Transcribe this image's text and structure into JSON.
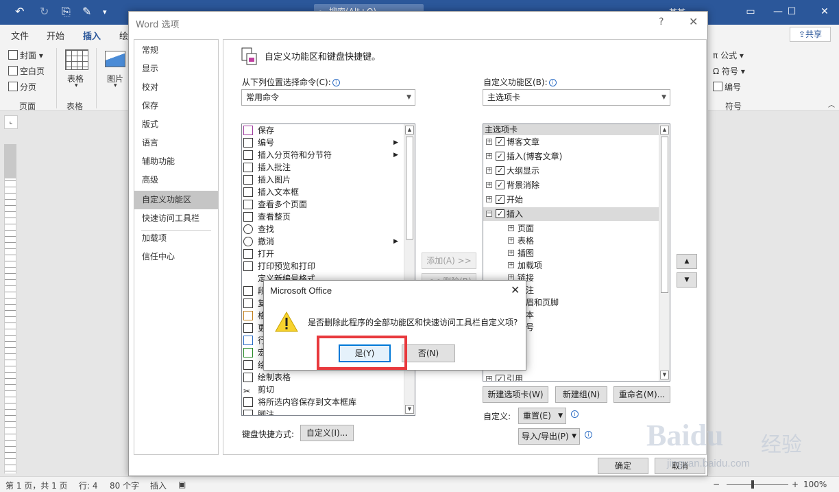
{
  "word": {
    "search_label": "搜索(Alt+Q)",
    "user_name": "某某",
    "ribbon_tabs": [
      "文件",
      "开始",
      "插入",
      "绘"
    ],
    "share_label": "共享",
    "ribbon": {
      "cover": "封面",
      "blank_page": "空白页",
      "page_break": "分页",
      "table": "表格",
      "picture": "图片",
      "group_pages": "页面",
      "group_table": "表格",
      "formula": "公式",
      "symbol": "符号",
      "numbering": "编号",
      "group_symbols": "符号"
    },
    "status": {
      "page": "第 1 页，共 1 页",
      "line": "行: 4",
      "words": "80 个字",
      "mode": "插入",
      "zoom": "100%"
    }
  },
  "options": {
    "title": "Word 选项",
    "help": "?",
    "close": "✕",
    "nav": [
      "常规",
      "显示",
      "校对",
      "保存",
      "版式",
      "语言",
      "辅助功能",
      "高级",
      "自定义功能区",
      "快速访问工具栏",
      "加载项",
      "信任中心"
    ],
    "nav_selected": "自定义功能区",
    "heading": "自定义功能区和键盘快捷键。",
    "choose_from_label": "从下列位置选择命令(C):",
    "choose_from_value": "常用命令",
    "customize_label": "自定义功能区(B):",
    "customize_value": "主选项卡",
    "commands": [
      "保存",
      "编号",
      "插入分页符和分节符",
      "插入批注",
      "插入图片",
      "插入文本框",
      "查看多个页面",
      "查看整页",
      "查找",
      "撤消",
      "打开",
      "打印预览和打印",
      "定义新编号格式...",
      "段",
      "复",
      "格",
      "更",
      "行",
      "宏",
      "绘",
      "绘制表格",
      "剪切",
      "将所选内容保存到文本框库",
      "脚注"
    ],
    "tree_header": "主选项卡",
    "tree_items": [
      "博客文章",
      "插入(博客文章)",
      "大纲显示",
      "背景消除",
      "开始",
      "插入"
    ],
    "tree_children": [
      "页面",
      "表格",
      "插图",
      "加载项",
      "链接",
      "注",
      "眉和页脚",
      "本",
      "号"
    ],
    "tree_last": "引用",
    "add_btn": "添加(A) >>",
    "remove_btn": "<< 删除(R)",
    "new_tab_btn": "新建选项卡(W)",
    "new_group_btn": "新建组(N)",
    "rename_btn": "重命名(M)...",
    "customizations_label": "自定义:",
    "reset_btn": "重置(E)",
    "import_export_btn": "导入/导出(P)",
    "keyboard_label": "键盘快捷方式:",
    "keyboard_btn": "自定义(I)...",
    "ok_btn": "确定",
    "cancel_btn": "取消"
  },
  "msgbox": {
    "title": "Microsoft Office",
    "close": "✕",
    "message": "是否删除此程序的全部功能区和快速访问工具栏自定义项?",
    "yes_btn": "是(Y)",
    "no_btn": "否(N)",
    "highlight_color": "#e8393d"
  },
  "watermark": {
    "logo": "Baidu",
    "cn": "经验",
    "url": "jingyan.baidu.com"
  }
}
